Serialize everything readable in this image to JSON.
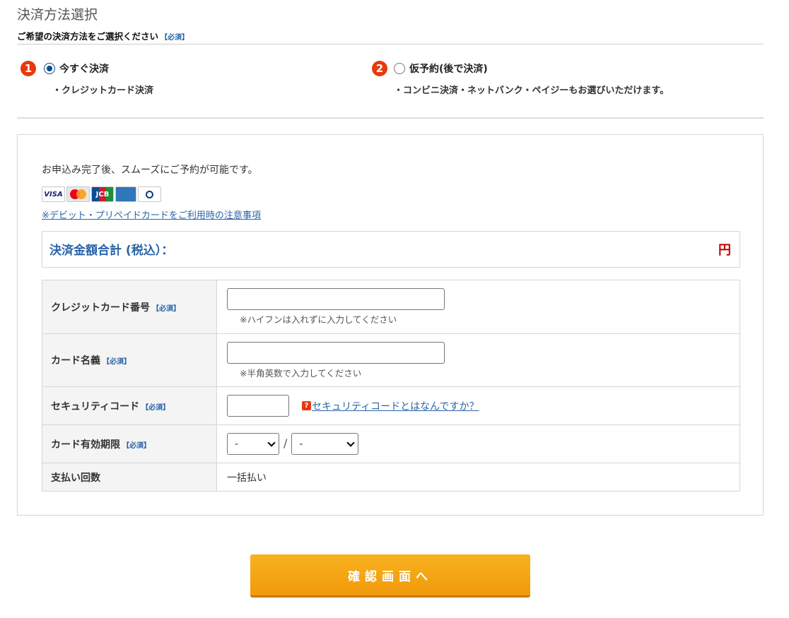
{
  "page": {
    "title": "決済方法選択",
    "subtitle": "ご希望の決済方法をご選択ください",
    "required_mark": "【必須】"
  },
  "options": [
    {
      "number": "1",
      "label": "今すぐ決済",
      "description": "・クレジットカード決済",
      "selected": true
    },
    {
      "number": "2",
      "label": "仮予約(後で決済)",
      "description": "・コンビニ決済・ネットバンク・ペイジーもお選びいただけます。",
      "selected": false
    }
  ],
  "panel": {
    "intro": "お申込み完了後、スムーズにご予約が可能です。",
    "card_brands": [
      "VISA",
      "MasterCard",
      "JCB",
      "AMERICAN EXPRESS",
      "Diners Club INTERNATIONAL"
    ],
    "notice_link": "※デビット・プリペイドカードをご利用時の注意事項",
    "total_label": "決済金額合計 (税込）：",
    "total_currency": "円"
  },
  "form": {
    "card_number": {
      "label": "クレジットカード番号",
      "required": "【必須】",
      "value": "",
      "hint": "※ハイフンは入れずに入力してください"
    },
    "card_name": {
      "label": "カード名義",
      "required": "【必須】",
      "value": "",
      "hint": "※半角英数で入力してください"
    },
    "security_code": {
      "label": "セキュリティコード",
      "required": "【必須】",
      "value": "",
      "help_icon": "?",
      "help_link": "セキュリティコードとはなんですか？"
    },
    "expiry": {
      "label": "カード有効期限",
      "required": "【必須】",
      "month": "-",
      "separator": "/",
      "year": "-"
    },
    "installments": {
      "label": "支払い回数",
      "value": "一括払い"
    }
  },
  "submit_label": "確認画面へ",
  "colors": {
    "accent_blue": "#2a64a8",
    "badge_red": "#e8380d",
    "submit_orange": "#f19a0b",
    "price_red": "#c00000"
  },
  "icons": {
    "help": "question-icon",
    "dropdown": "chevron-down-icon"
  }
}
